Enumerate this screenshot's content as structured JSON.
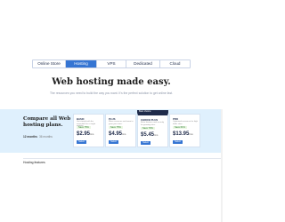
{
  "tabs": [
    {
      "label": "Online Store",
      "active": false
    },
    {
      "label": "Hosting",
      "active": true
    },
    {
      "label": "VPS",
      "active": false
    },
    {
      "label": "Dedicated",
      "active": false
    },
    {
      "label": "Cloud",
      "active": false
    }
  ],
  "hero": {
    "title": "Web hosting made easy.",
    "subtitle": "The resources you need to build the way you want. It's the perfect solution to get online fast."
  },
  "compare": {
    "title": "Compare all Web hosting plans.",
    "terms": [
      "12 months",
      "36 months"
    ]
  },
  "plans": [
    {
      "name": "BASIC",
      "desc": "Get started with the essentials for a single website.",
      "save": "Save 75%",
      "price": "$2.95",
      "per": "/mo",
      "button": "Select"
    },
    {
      "name": "PLUS",
      "desc": "More resources and room to grow your sites.",
      "save": "Save 75%",
      "price": "$4.95",
      "per": "/mo",
      "button": "Select"
    },
    {
      "name": "CHOICE PLUS",
      "desc": "Extra features and security for growing sites.",
      "save": "Save 70%",
      "price": "$5.45",
      "per": "/mo",
      "button": "Select",
      "featured": true
    },
    {
      "name": "PRO",
      "desc": "Optimized resources for high traffic sites.",
      "save": "Save 61%",
      "price": "$13.95",
      "per": "/mo",
      "button": "Select"
    }
  ],
  "featured_badge": "Best choice",
  "features_heading": "Hosting features",
  "colors": {
    "accent": "#3575d3",
    "navy": "#1f2b4a",
    "band": "#dff0fd"
  }
}
